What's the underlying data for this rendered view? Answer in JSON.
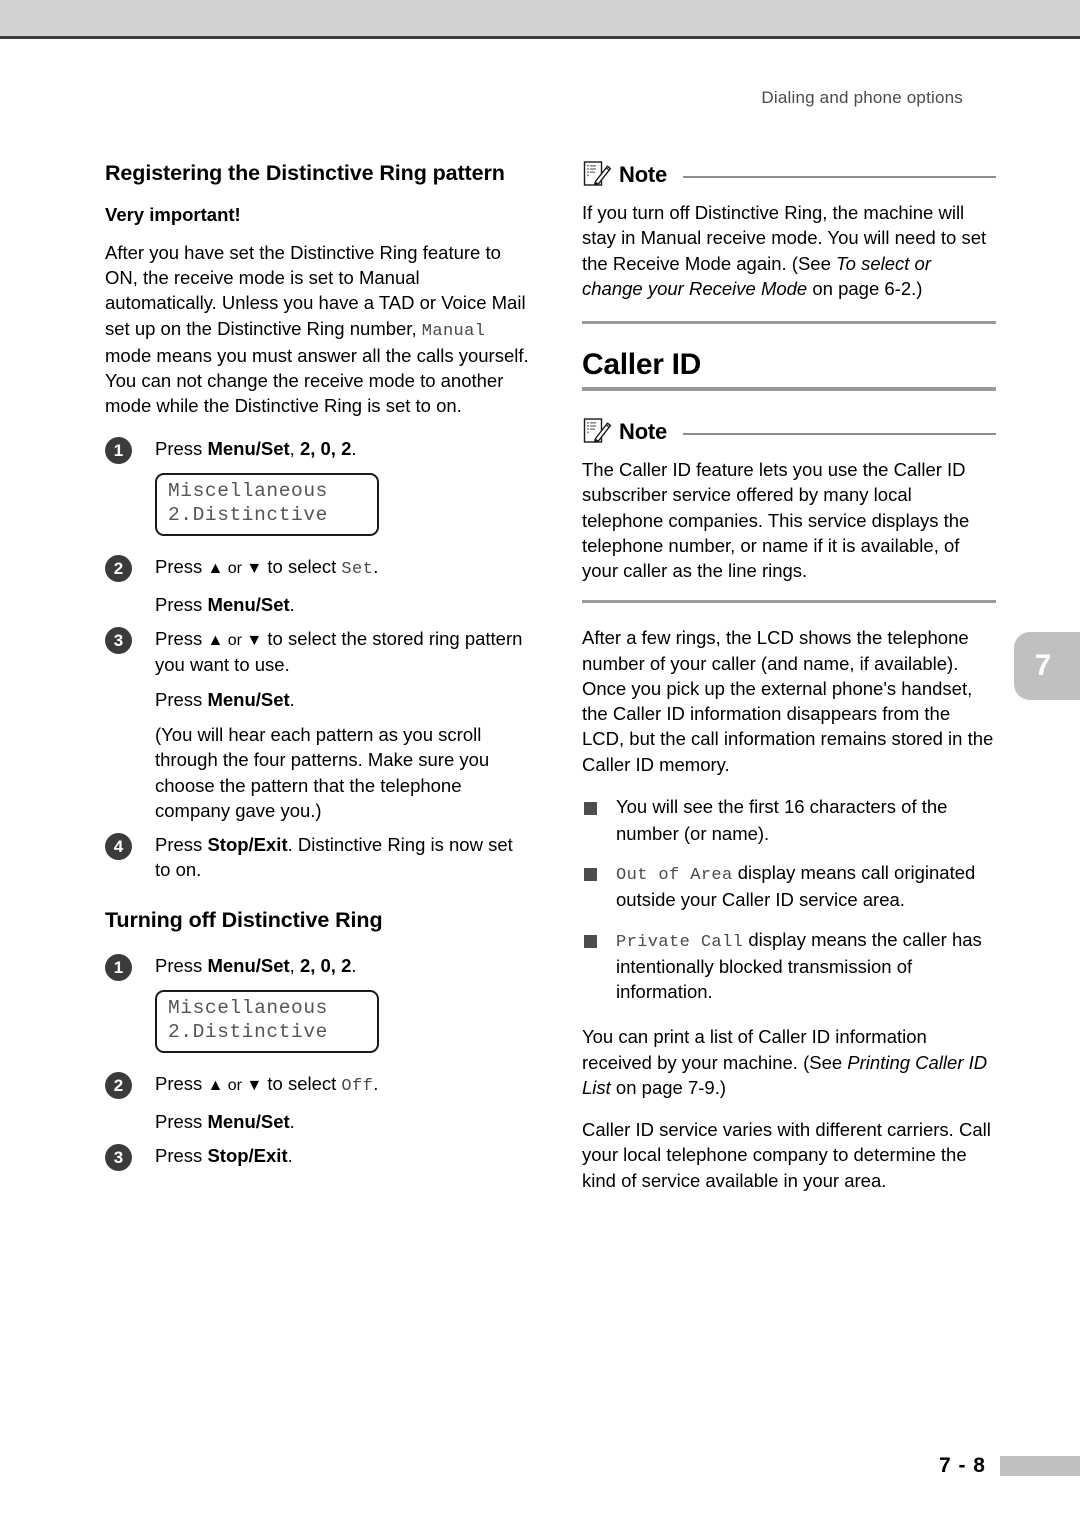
{
  "header": {
    "running_title": "Dialing and phone options",
    "chapter_tab": "7"
  },
  "footer": {
    "page_number": "7 - 8"
  },
  "left_column": {
    "section_title": "Registering the Distinctive Ring pattern",
    "sub_title": "Very important!",
    "intro_p1": "After you have set the Distinctive Ring feature to ON, the receive mode is set to Manual automatically. Unless you have a TAD or Voice Mail set up on the Distinctive Ring number, ",
    "intro_mono": "Manual",
    "intro_p2": " mode means you must answer all the calls yourself. You can not change the receive mode to another mode while the Distinctive Ring is set to on.",
    "steps": [
      {
        "num": "1",
        "pre": "Press ",
        "key": "Menu/Set",
        "post": ", ",
        "keys_bold": "2, 0, 2",
        "tail": "."
      },
      {
        "num": "2",
        "line1_pre": "Press ",
        "line1_arrows": "▲ or ▼",
        "line1_mid": " to select ",
        "line1_mono": "Set",
        "line1_tail": ".",
        "line2_pre": "Press ",
        "line2_key": "Menu/Set",
        "line2_tail": "."
      },
      {
        "num": "3",
        "line1_pre": "Press ",
        "line1_arrows": "▲ or ▼",
        "line1_rest": " to select the stored ring pattern you want to use.",
        "line2_pre": "Press ",
        "line2_key": "Menu/Set",
        "line2_tail": ".",
        "line3": "(You will hear each pattern as you scroll through the four patterns. Make sure you choose the pattern that the telephone company gave you.)"
      },
      {
        "num": "4",
        "pre": "Press ",
        "key": "Stop/Exit",
        "rest": ". Distinctive Ring is now set to on."
      }
    ],
    "lcd_1": {
      "line1": "Miscellaneous",
      "line2": "2.Distinctive"
    },
    "turning_off_title": "Turning off Distinctive Ring",
    "off_steps": [
      {
        "num": "1",
        "pre": "Press ",
        "key": "Menu/Set",
        "post": ", ",
        "keys_bold": "2, 0, 2",
        "tail": "."
      },
      {
        "num": "2",
        "line1_pre": "Press ",
        "line1_arrows": "▲ or ▼",
        "line1_mid": " to select ",
        "line1_mono": "Off",
        "line1_tail": ".",
        "line2_pre": "Press ",
        "line2_key": "Menu/Set",
        "line2_tail": "."
      },
      {
        "num": "3",
        "pre": "Press ",
        "key": "Stop/Exit",
        "tail": "."
      }
    ],
    "lcd_2": {
      "line1": "Miscellaneous",
      "line2": "2.Distinctive"
    }
  },
  "right_column": {
    "note_1": {
      "label": "Note",
      "text_a": "If you turn off Distinctive Ring, the machine will stay in  Manual  receive mode. You will need to set the Receive Mode again. (See ",
      "text_italic": "select or change your Receive Mode",
      "text_italic_lead": "To",
      "text_b": " on page 6-2.)"
    },
    "major_title": "Caller ID",
    "note_2": {
      "label": "Note",
      "text": "The Caller ID feature lets you use the Caller ID subscriber service offered by many local telephone companies. This service displays the telephone number, or name if it is available, of your caller as the line rings."
    },
    "para_lcd": "After a few rings, the LCD shows the telephone number of your caller (and name, if available). Once you pick up the external phone's handset, the Caller ID information disappears from the LCD, but the call information remains stored in the Caller ID memory.",
    "bullets": [
      {
        "mono": "",
        "text": "You will see the first 16 characters of the number (or name)."
      },
      {
        "mono": "Out of Area",
        "text": " display means call originated outside your Caller ID service area."
      },
      {
        "mono": "Private Call",
        "text": " display means the caller has intentionally blocked transmission of information."
      }
    ],
    "para_print_a": "You can print a list of Caller ID information received by your machine. (See ",
    "para_print_italic": "Printing Caller ID List",
    "para_print_b": " on page 7-9.)",
    "para_carriers": "Caller ID service varies with different carriers. Call your local telephone company to determine the kind of service available in your area."
  },
  "colors": {
    "band": "#d2d2d2",
    "band_border": "#3c3c3c",
    "step_marker": "#3b3b3b",
    "bullet": "#4d4d4d",
    "rule": "#9a9a9a",
    "tab": "#c0c0c0"
  }
}
